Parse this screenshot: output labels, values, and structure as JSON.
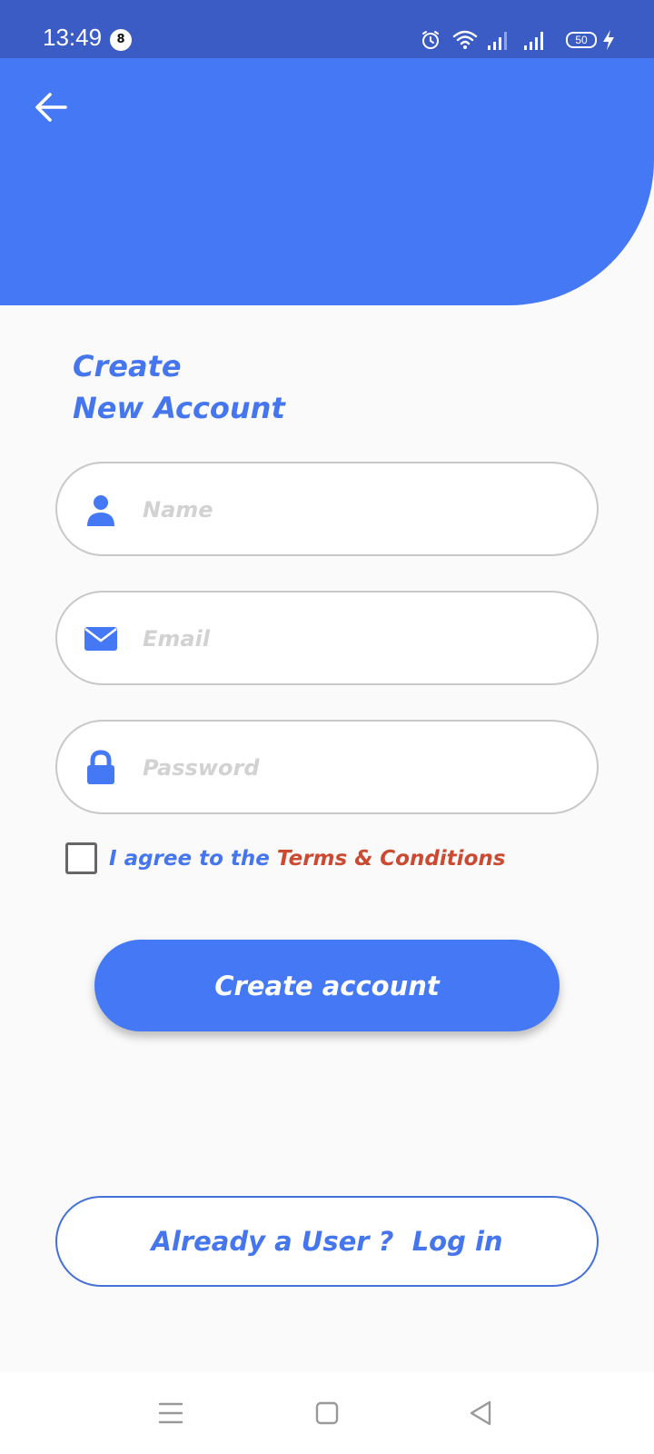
{
  "status_bar": {
    "time": "13:49",
    "notification_count": "8",
    "battery_level": "50"
  },
  "header": {
    "back_icon": "arrow-left-icon"
  },
  "title": {
    "line1": "Create",
    "line2": "New Account"
  },
  "form": {
    "name_placeholder": "Name",
    "email_placeholder": "Email",
    "password_placeholder": "Password",
    "name_icon": "person-icon",
    "email_icon": "envelope-icon",
    "password_icon": "lock-icon"
  },
  "terms": {
    "prefix": "I agree to the ",
    "link": "Terms & Conditions",
    "checked": false
  },
  "buttons": {
    "create_account": "Create account",
    "login": "Already a User ?  Log in"
  },
  "colors": {
    "status_bar": "#3a5cc4",
    "primary": "#4478f5",
    "title_text": "#4576ee",
    "terms_link": "#cc4a32",
    "placeholder": "#d2d2d2"
  },
  "nav_bar": {
    "menu_icon": "menu-icon",
    "home_icon": "square-home-icon",
    "back_icon": "triangle-back-icon"
  }
}
